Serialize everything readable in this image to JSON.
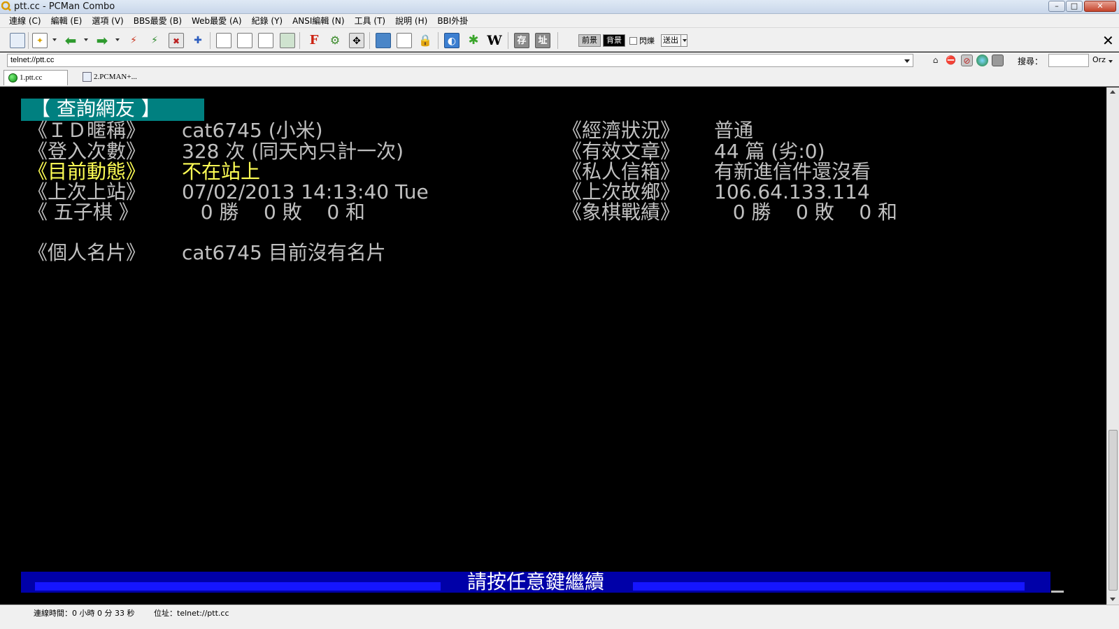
{
  "window": {
    "title": "ptt.cc - PCMan Combo",
    "min": "–",
    "max": "□",
    "close": "✕"
  },
  "menu": [
    "連線 (C)",
    "編輯 (E)",
    "選項 (V)",
    "BBS最愛 (B)",
    "Web最愛 (A)",
    "紀錄 (Y)",
    "ANSI編輯 (N)",
    "工具 (T)",
    "說明 (H)",
    "BBI外掛"
  ],
  "toolbar": {
    "font_glyph": "F",
    "wiki_glyph": "W",
    "save_glyph": "存",
    "address_glyph": "址",
    "fg_label": "前景",
    "bg_label": "背景",
    "blink_label": "閃爍",
    "send_label": "送出",
    "close_glyph": "✕"
  },
  "address": {
    "value": "telnet://ptt.cc",
    "search_label": "搜尋：",
    "orz_label": "Orz"
  },
  "tabs": [
    {
      "label": "1.ptt.cc"
    },
    {
      "label": "2.PCMAN+..."
    }
  ],
  "terminal": {
    "heading": "【 查詢網友 】",
    "rows": {
      "id": {
        "label": "《ＩＤ暱稱》",
        "value": "cat6745 (小米)"
      },
      "economy": {
        "label": "《經濟狀況》",
        "value": "普通"
      },
      "logins": {
        "label": "《登入次數》",
        "value": "328 次 (同天內只計一次)"
      },
      "posts": {
        "label": "《有效文章》",
        "value": "44 篇 (劣:0)"
      },
      "status": {
        "label": "《目前動態》",
        "value": "不在站上"
      },
      "mailbox": {
        "label": "《私人信箱》",
        "value": "有新進信件還沒看"
      },
      "last_login": {
        "label": "《上次上站》",
        "value": "07/02/2013 14:13:40 Tue"
      },
      "last_ip": {
        "label": "《上次故鄉》",
        "value": "106.64.133.114"
      },
      "gomoku": {
        "label": "《 五子棋 》",
        "value": "   0 勝    0 敗    0 和"
      },
      "chess": {
        "label": "《象棋戰績》",
        "value": "   0 勝    0 敗    0 和"
      },
      "card": {
        "label": "《個人名片》",
        "value": "cat6745 目前沒有名片"
      }
    },
    "footer": "請按任意鍵繼續"
  },
  "status": {
    "time": "連線時間：0 小時 0 分 33 秒",
    "address": "位址：telnet://ptt.cc"
  },
  "colors": {
    "terminal_bg": "#000000",
    "terminal_fg": "#c0c0c0",
    "heading_bg": "#008080",
    "highlight": "#ffff55",
    "footer_bg": "#0000a8"
  }
}
